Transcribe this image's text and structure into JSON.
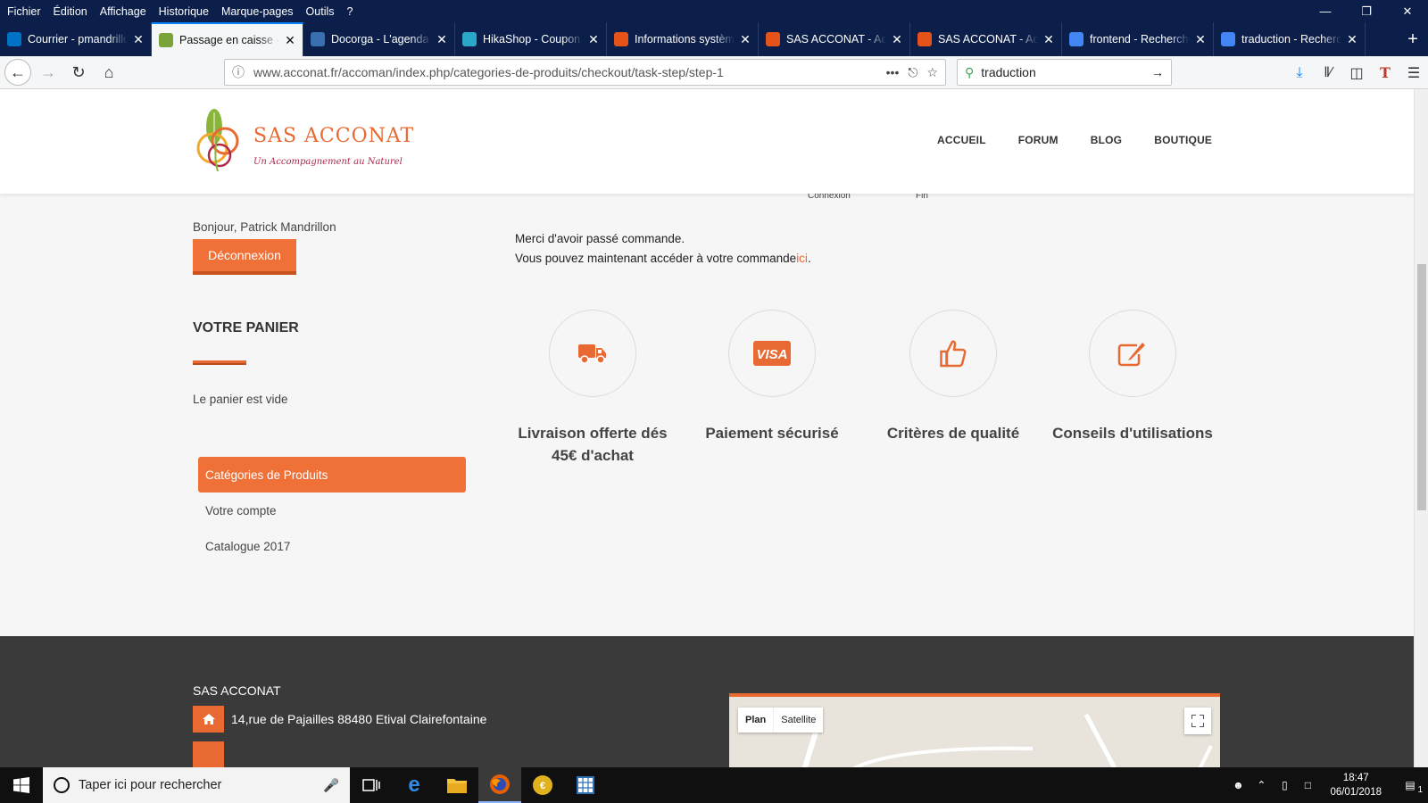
{
  "browser": {
    "menu": [
      "Fichier",
      "Édition",
      "Affichage",
      "Historique",
      "Marque-pages",
      "Outils",
      "?"
    ],
    "tabs": [
      {
        "title": "Courrier - pmandrillon",
        "icon": "outlook-icon",
        "color": "#0072c6"
      },
      {
        "title": "Passage en caisse - SAS",
        "icon": "acconat-icon",
        "color": "#7aa33a"
      },
      {
        "title": "Docorga - L'agenda de",
        "icon": "docorga-icon",
        "color": "#3a6fb0"
      },
      {
        "title": "HikaShop - Coupon de",
        "icon": "hikashop-icon",
        "color": "#2aa7c9"
      },
      {
        "title": "Informations système",
        "icon": "joomla-icon",
        "color": "#e5531a"
      },
      {
        "title": "SAS ACCONAT - Admin",
        "icon": "joomla-icon",
        "color": "#e5531a"
      },
      {
        "title": "SAS ACCONAT - Admin",
        "icon": "joomla-icon",
        "color": "#e5531a"
      },
      {
        "title": "frontend - Recherche",
        "icon": "google-icon",
        "color": "#4285f4"
      },
      {
        "title": "traduction - Recherche",
        "icon": "google-icon",
        "color": "#4285f4"
      }
    ],
    "active_tab": 1,
    "url": "www.acconat.fr/accoman/index.php/categories-de-produits/checkout/task-step/step-1",
    "search_value": "traduction"
  },
  "site": {
    "brand": "SAS ACCONAT",
    "tagline": "Un Accompagnement au Naturel",
    "nav": [
      "ACCUEIL",
      "FORUM",
      "BLOG",
      "BOUTIQUE"
    ],
    "steps": [
      "Connexion",
      "Fin"
    ],
    "greeting": "Bonjour, Patrick Mandrillon",
    "logout_label": "Déconnexion",
    "cart_title": "VOTRE PANIER",
    "cart_empty": "Le panier est vide",
    "categories": [
      "Catégories de Produits",
      "Votre compte",
      "Catalogue 2017"
    ],
    "thanks_line1": "Merci d'avoir passé commande.",
    "thanks_line2": "Vous pouvez maintenant accéder à votre commande",
    "thanks_link": "ici",
    "thanks_end": ".",
    "features": [
      {
        "icon": "truck-icon",
        "title": "Livraison offerte dés 45€ d'achat"
      },
      {
        "icon": "visa-icon",
        "title": "Paiement sécurisé"
      },
      {
        "icon": "thumbs-up-icon",
        "title": "Critères de qualité"
      },
      {
        "icon": "edit-icon",
        "title": "Conseils d'utilisations"
      }
    ],
    "accent": "#e86a32"
  },
  "footer": {
    "company": "SAS ACCONAT",
    "address": "14,rue de Pajailles 88480 Etival Clairefontaine",
    "map_plan": "Plan",
    "map_satellite": "Satellite"
  },
  "taskbar": {
    "search_placeholder": "Taper ici pour rechercher",
    "time": "18:47",
    "date": "06/01/2018",
    "notifications": "1"
  }
}
